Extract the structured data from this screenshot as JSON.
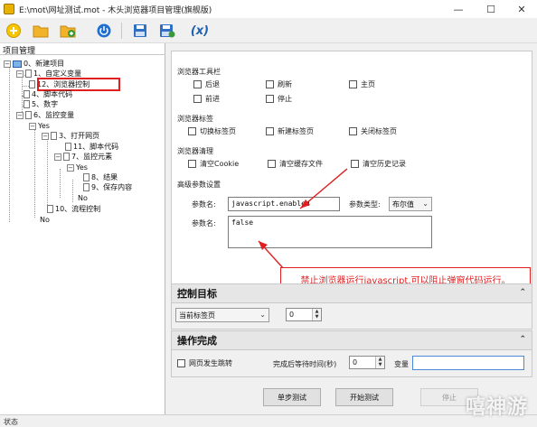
{
  "window": {
    "title": "E:\\mot\\网址测试.mot - 木头浏览器项目管理(旗舰版)",
    "minimize": "—",
    "maximize": "☐",
    "close": "✕"
  },
  "toolbar": {
    "items": [
      "new-icon",
      "open-folder-icon",
      "add-folder-icon",
      "power-icon",
      "save-icon",
      "save-as-icon",
      "variable-icon"
    ],
    "variable_label": "(x)"
  },
  "left_panel": {
    "title": "项目管理",
    "tree": [
      {
        "id": "n0",
        "label": "0、新建项目"
      },
      {
        "id": "n1",
        "label": "1、自定义变量"
      },
      {
        "id": "n12",
        "label": "12、浏览器控制"
      },
      {
        "id": "n4",
        "label": "4、脚本代码"
      },
      {
        "id": "n5",
        "label": "5、数字"
      },
      {
        "id": "n6",
        "label": "6、监控变量"
      },
      {
        "id": "yes1",
        "label": "Yes"
      },
      {
        "id": "n3",
        "label": "3、打开网页"
      },
      {
        "id": "n11",
        "label": "11、脚本代码"
      },
      {
        "id": "n7",
        "label": "7、监控元素"
      },
      {
        "id": "yes2",
        "label": "Yes"
      },
      {
        "id": "n8",
        "label": "8、结果"
      },
      {
        "id": "n9",
        "label": "9、保存内容"
      },
      {
        "id": "no2",
        "label": "No"
      },
      {
        "id": "n10",
        "label": "10、流程控制"
      },
      {
        "id": "no1",
        "label": "No"
      }
    ]
  },
  "browser_toolbar": {
    "heading": "浏览器工具栏",
    "options": [
      "后退",
      "刷新",
      "主页",
      "前进",
      "停止"
    ]
  },
  "browser_tabs": {
    "heading": "浏览器标签",
    "options": [
      "切换标签页",
      "新建标签页",
      "关闭标签页"
    ]
  },
  "browser_clear": {
    "heading": "浏览器清理",
    "options": [
      "清空Cookie",
      "清空缓存文件",
      "清空历史记录"
    ]
  },
  "advanced": {
    "heading": "高级参数设置",
    "param_name_label": "参数名:",
    "param_name_value": "javascript.enabled",
    "param_type_label": "参数类型:",
    "param_type_value": "布尔值",
    "param_value_label": "参数名:",
    "param_value_value": "false"
  },
  "annotation": {
    "text": "禁止浏览器运行javascript,可以阻止弹窗代码运行。",
    "color": "#e02020"
  },
  "control_target": {
    "heading": "控制目标",
    "target_value": "当前标签页",
    "index_value": "0"
  },
  "operation_done": {
    "heading": "操作完成",
    "page_jump_label": "网页发生跳转",
    "wait_label": "完成后等待时间(秒)",
    "wait_value": "0",
    "variable_label": "变量",
    "variable_value": ""
  },
  "buttons": {
    "step_test": "单步测试",
    "start_test": "开始测试",
    "stop": "停止"
  },
  "statusbar": {
    "text": "状态"
  },
  "watermark": "嘻神游"
}
